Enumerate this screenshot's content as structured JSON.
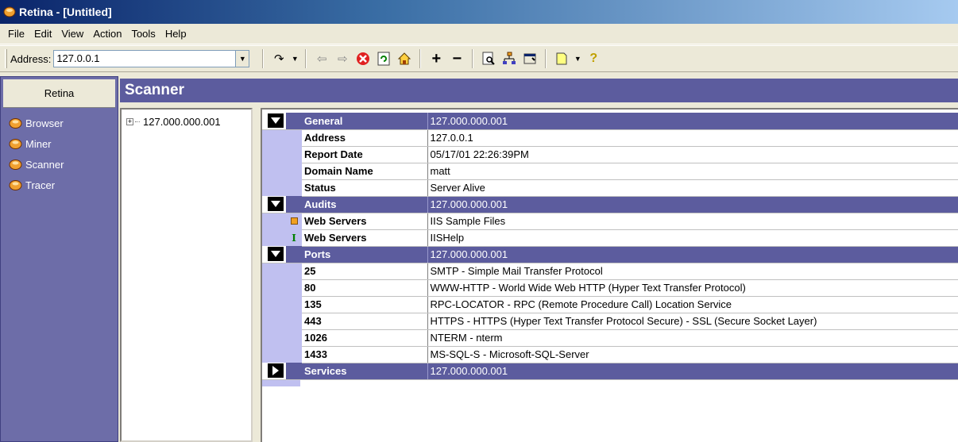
{
  "window": {
    "title": "Retina - [Untitled]"
  },
  "menu": [
    "File",
    "Edit",
    "View",
    "Action",
    "Tools",
    "Help"
  ],
  "toolbar": {
    "address_label": "Address:",
    "address_value": "127.0.0.1",
    "icons": [
      "go-icon",
      "back-icon",
      "forward-icon",
      "stop-icon",
      "refresh-icon",
      "home-icon",
      "add-icon",
      "remove-icon",
      "find-icon",
      "tree-icon",
      "properties-icon",
      "new-icon",
      "help-icon"
    ]
  },
  "nav": {
    "header": "Retina",
    "items": [
      "Browser",
      "Miner",
      "Scanner",
      "Tracer"
    ]
  },
  "main": {
    "title": "Scanner"
  },
  "tree": {
    "node": "127.000.000.001"
  },
  "report": {
    "sections": [
      {
        "label": "General",
        "value": "127.000.000.001",
        "expanded": true,
        "rows": [
          {
            "label": "Address",
            "value": "127.0.0.1"
          },
          {
            "label": "Report Date",
            "value": "05/17/01 22:26:39PM"
          },
          {
            "label": "Domain Name",
            "value": "matt"
          },
          {
            "label": "Status",
            "value": "Server Alive"
          }
        ]
      },
      {
        "label": "Audits",
        "value": "127.000.000.001",
        "expanded": true,
        "rows": [
          {
            "label": "Web Servers",
            "value": "IIS Sample Files",
            "icon": "orange"
          },
          {
            "label": "Web Servers",
            "value": "IISHelp",
            "icon": "green"
          }
        ]
      },
      {
        "label": "Ports",
        "value": "127.000.000.001",
        "expanded": true,
        "rows": [
          {
            "label": "25",
            "value": "SMTP - Simple Mail Transfer Protocol"
          },
          {
            "label": "80",
            "value": "WWW-HTTP - World Wide Web HTTP (Hyper Text Transfer Protocol)"
          },
          {
            "label": "135",
            "value": "RPC-LOCATOR - RPC (Remote Procedure Call) Location Service"
          },
          {
            "label": "443",
            "value": "HTTPS - HTTPS (Hyper Text Transfer Protocol Secure) - SSL (Secure Socket Layer)"
          },
          {
            "label": "1026",
            "value": "NTERM - nterm"
          },
          {
            "label": "1433",
            "value": "MS-SQL-S - Microsoft-SQL-Server"
          }
        ]
      },
      {
        "label": "Services",
        "value": "127.000.000.001",
        "expanded": false,
        "rows": []
      }
    ]
  },
  "colors": {
    "section_bg": "#5c5c9e",
    "gutter": "#c0c0f0",
    "nav_bg": "#6d6da8"
  }
}
